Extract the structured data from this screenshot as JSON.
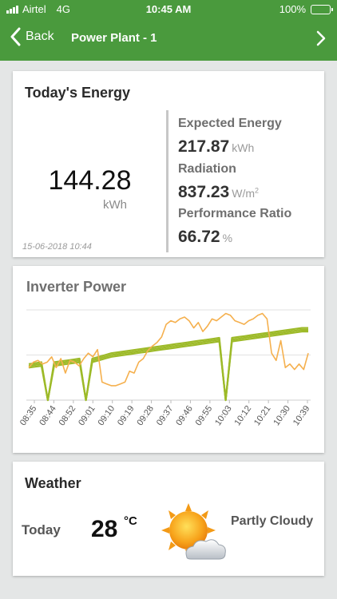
{
  "status_bar": {
    "carrier": "Airtel",
    "network": "4G",
    "time": "10:45 AM",
    "battery": "100%"
  },
  "nav": {
    "back_label": "Back",
    "title": "Power Plant - 1"
  },
  "energy": {
    "title": "Today's Energy",
    "value": "144.28",
    "unit": "kWh",
    "timestamp": "15-06-2018 10:44",
    "expected_label": "Expected Energy",
    "expected_value": "217.87",
    "expected_unit": "kWh",
    "radiation_label": "Radiation",
    "radiation_value": "837.23",
    "radiation_unit": "W/m",
    "radiation_unit_sup": "2",
    "pr_label": "Performance Ratio",
    "pr_value": "66.72",
    "pr_unit": "%"
  },
  "inverter": {
    "title": "Inverter Power"
  },
  "chart_data": {
    "type": "line",
    "title": "Inverter Power",
    "x_ticks": [
      "08:35",
      "08:44",
      "08:52",
      "09:01",
      "09:10",
      "09:19",
      "09:28",
      "09:37",
      "09:46",
      "09:55",
      "10:03",
      "10:12",
      "10:21",
      "10:30",
      "10:39"
    ],
    "grid": true,
    "ylim": [
      0,
      100
    ],
    "colors": {
      "inverters": "#9dba28",
      "actual": "#f5b04e"
    },
    "series": [
      {
        "values": [
          40,
          41,
          42,
          0,
          42,
          43,
          44,
          45,
          46,
          0,
          46,
          48,
          50,
          52,
          53,
          54,
          55,
          56,
          57,
          58,
          59,
          60,
          61,
          62,
          63,
          64,
          65,
          66,
          67,
          68,
          69,
          0,
          69,
          70,
          71,
          72,
          73,
          74,
          75,
          76,
          77,
          78,
          79,
          80,
          80
        ]
      },
      {
        "values": [
          38,
          39,
          40,
          0,
          40,
          41,
          42,
          43,
          44,
          0,
          44,
          46,
          48,
          50,
          51,
          52,
          53,
          54,
          55,
          56,
          57,
          58,
          59,
          60,
          61,
          62,
          63,
          64,
          65,
          66,
          67,
          0,
          67,
          68,
          69,
          70,
          71,
          72,
          73,
          74,
          75,
          76,
          77,
          78,
          78
        ]
      },
      {
        "values": [
          36,
          37,
          38,
          0,
          38,
          39,
          40,
          41,
          42,
          0,
          42,
          44,
          46,
          48,
          49,
          50,
          51,
          52,
          53,
          54,
          55,
          56,
          57,
          58,
          59,
          60,
          61,
          62,
          63,
          64,
          65,
          0,
          65,
          66,
          67,
          68,
          69,
          70,
          71,
          72,
          73,
          74,
          75,
          76,
          76
        ]
      },
      {
        "values": [
          36,
          42,
          44,
          40,
          42,
          48,
          36,
          46,
          30,
          44,
          42,
          38,
          46,
          52,
          48,
          56,
          20,
          18,
          16,
          16,
          18,
          20,
          32,
          30,
          42,
          46,
          55,
          60,
          64,
          70,
          84,
          88,
          86,
          90,
          92,
          88,
          80,
          86,
          76,
          82,
          90,
          88,
          92,
          96,
          94,
          88,
          86,
          84,
          88,
          90,
          94,
          96,
          90,
          52,
          44,
          66,
          36,
          40,
          34,
          40,
          34,
          52
        ]
      }
    ]
  },
  "weather": {
    "title": "Weather",
    "day": "Today",
    "temperature": "28",
    "unit": "°C",
    "condition": "Partly Cloudy",
    "icon": "partly-cloudy-icon"
  }
}
